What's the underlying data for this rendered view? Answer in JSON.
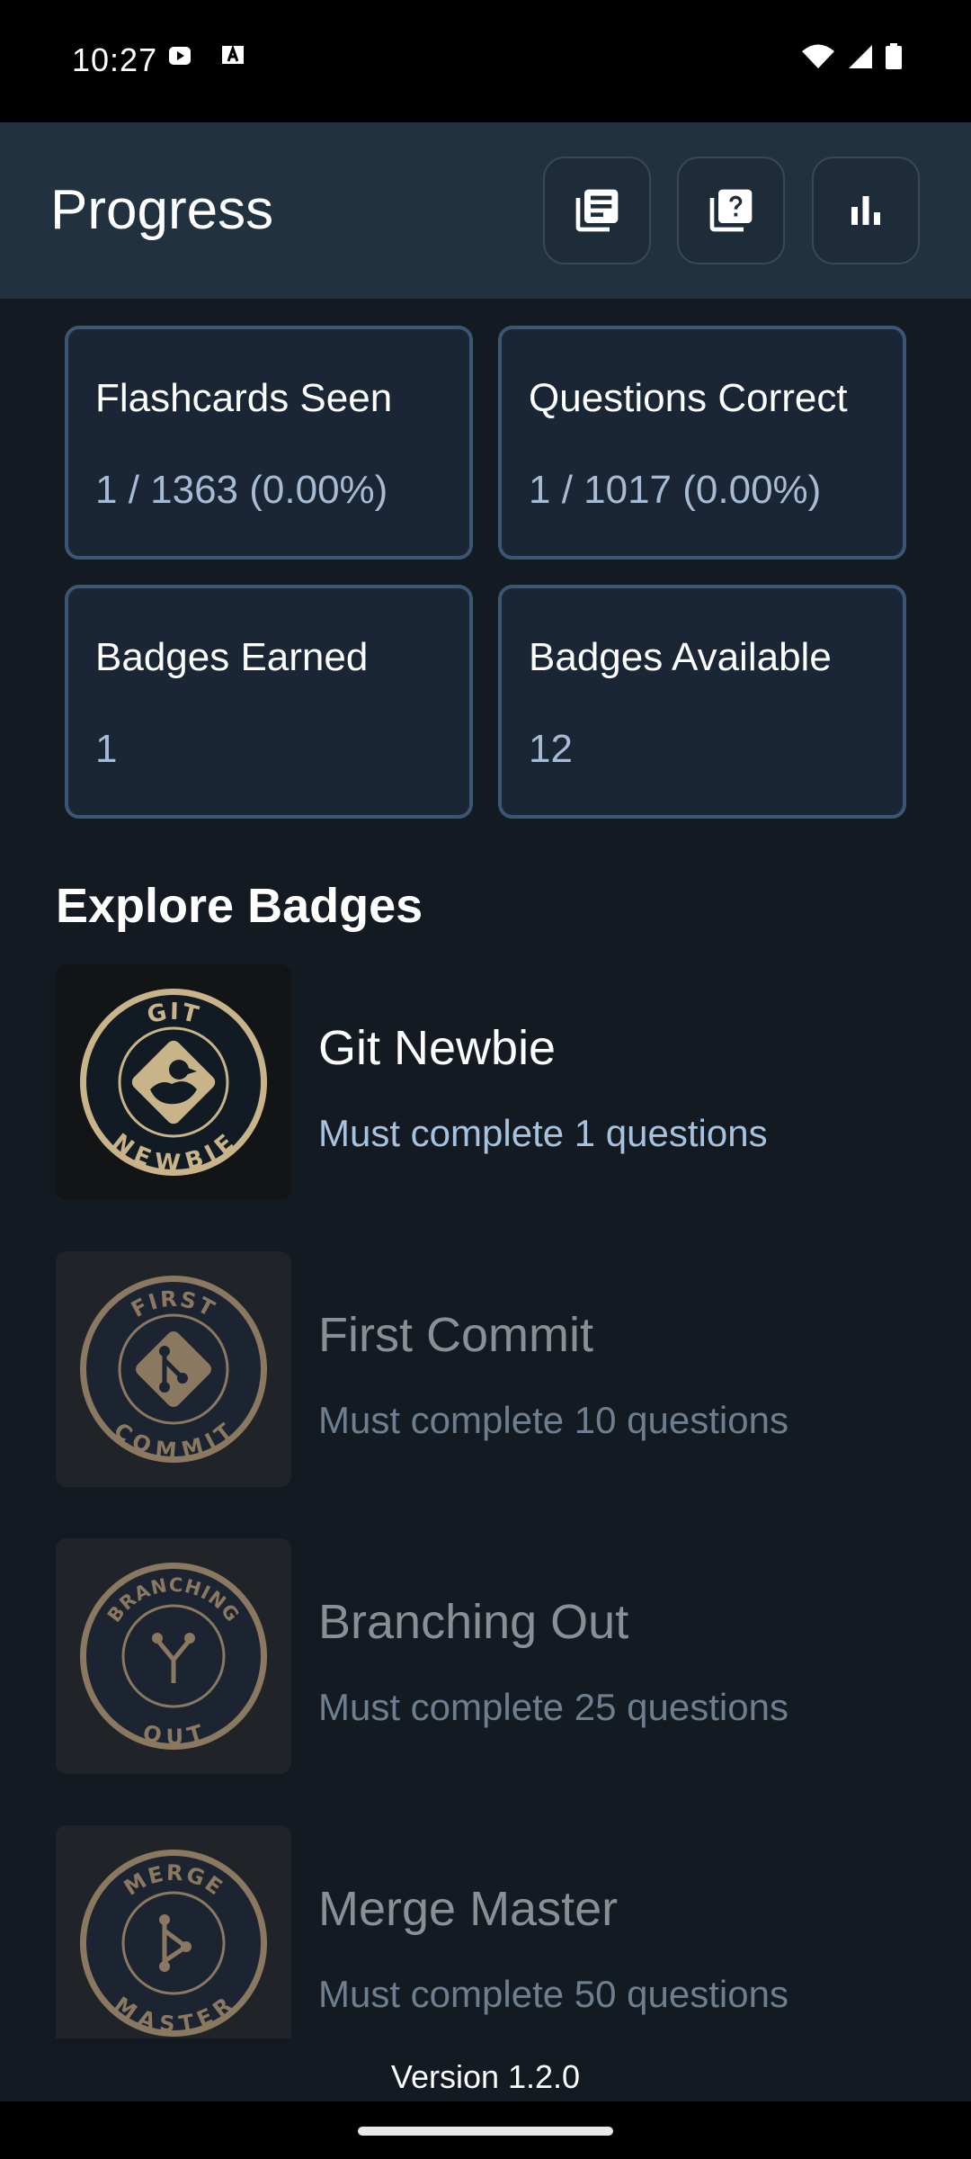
{
  "status_bar": {
    "time": "10:27"
  },
  "app_bar": {
    "title": "Progress",
    "actions": [
      {
        "name": "flashcards-button",
        "icon": "library-books-icon"
      },
      {
        "name": "quiz-button",
        "icon": "quiz-question-icon"
      },
      {
        "name": "stats-button",
        "icon": "bar-chart-icon"
      }
    ]
  },
  "stats": [
    {
      "label": "Flashcards Seen",
      "value": "1 / 1363 (0.00%)"
    },
    {
      "label": "Questions Correct",
      "value": "1 / 1017 (0.00%)"
    },
    {
      "label": "Badges Earned",
      "value": "1"
    },
    {
      "label": "Badges Available",
      "value": "12"
    }
  ],
  "badges_section": {
    "title": "Explore Badges",
    "items": [
      {
        "name": "Git Newbie",
        "desc": "Must complete 1 questions",
        "earned": true,
        "emblem_top": "GIT",
        "emblem_bottom": "NEWBIE",
        "icon": "duck-icon"
      },
      {
        "name": "First Commit",
        "desc": "Must complete 10 questions",
        "earned": false,
        "emblem_top": "FIRST",
        "emblem_bottom": "COMMIT",
        "icon": "git-diamond-icon"
      },
      {
        "name": "Branching Out",
        "desc": "Must complete 25 questions",
        "earned": false,
        "emblem_top": "BRANCHING",
        "emblem_bottom": "OUT",
        "icon": "branch-icon"
      },
      {
        "name": "Merge Master",
        "desc": "Must complete 50 questions",
        "earned": false,
        "emblem_top": "MERGE",
        "emblem_bottom": "MASTER",
        "icon": "merge-icon"
      }
    ]
  },
  "footer": {
    "version": "Version 1.2.0"
  },
  "colors": {
    "background": "#131a22",
    "app_bar": "#223140",
    "card_border": "#3b5573",
    "badge_gold": "#c9b48a"
  }
}
